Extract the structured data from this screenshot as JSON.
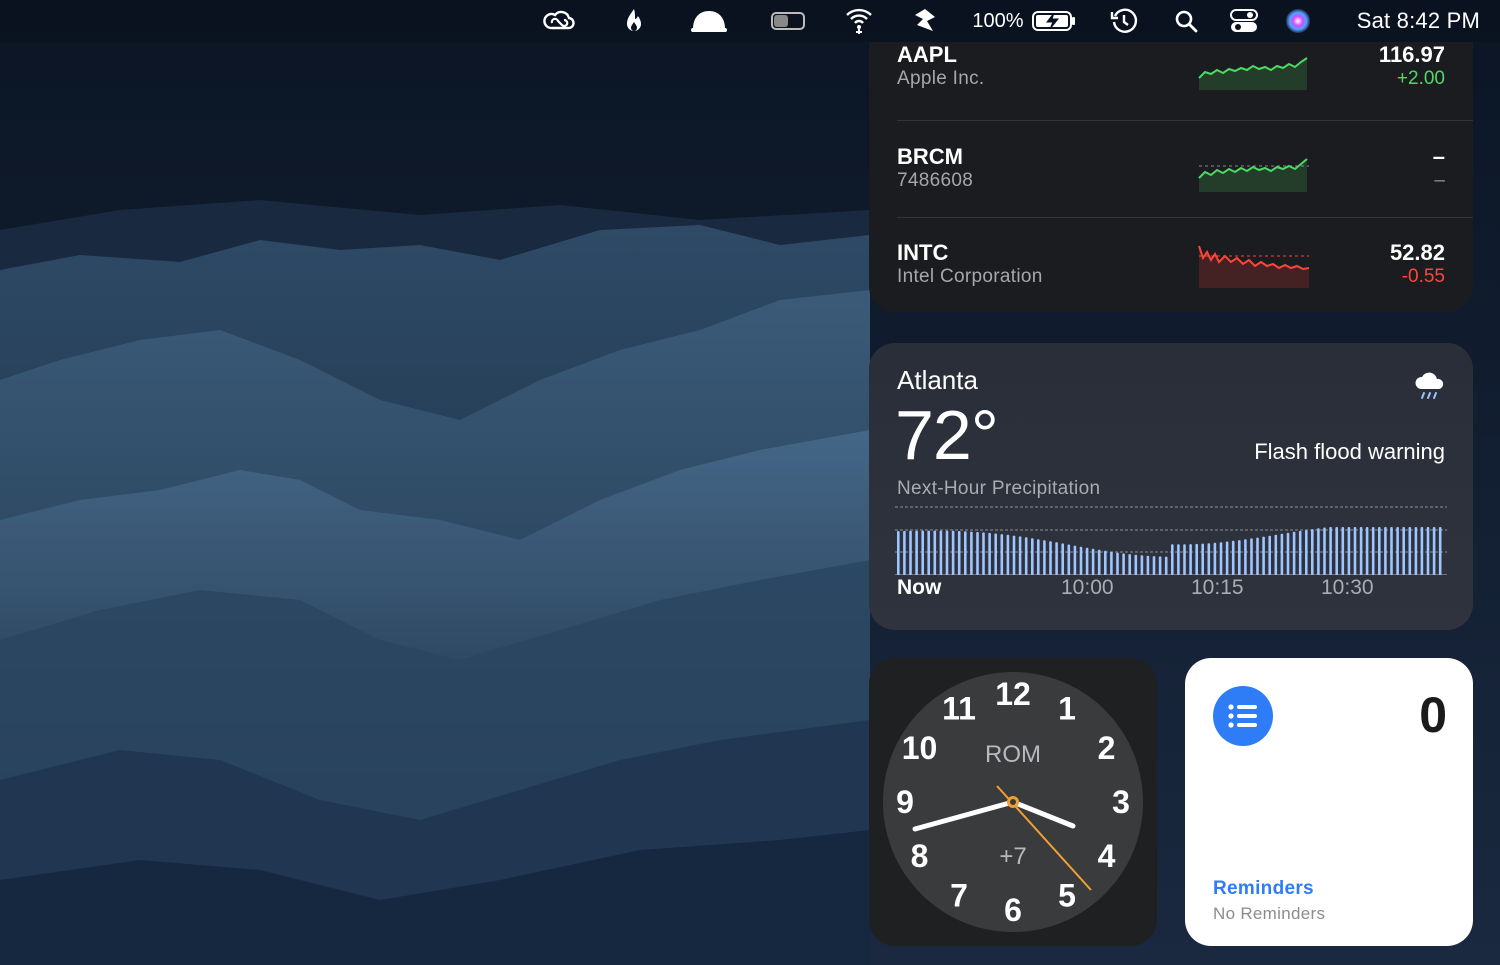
{
  "menubar": {
    "icons": [
      "creative-cloud-icon",
      "flame-icon",
      "bell-dome-icon",
      "toggle-icon",
      "wifi-icon",
      "app-shield-icon",
      "battery-icon",
      "time-machine-icon",
      "search-icon",
      "control-center-icon",
      "siri-icon"
    ],
    "battery_percent": "100%",
    "clock": "Sat 8:42 PM"
  },
  "stocks": {
    "rows": [
      {
        "symbol": "AAPL",
        "name": "Apple Inc.",
        "price": "116.97",
        "change": "+2.00",
        "change_color": "#4cd964",
        "trend": "up"
      },
      {
        "symbol": "BRCM",
        "name": "7486608",
        "price": "–",
        "change": "–",
        "change_color": "#8e8e93",
        "trend": "up"
      },
      {
        "symbol": "INTC",
        "name": "Intel Corporation",
        "price": "52.82",
        "change": "-0.55",
        "change_color": "#ff453a",
        "trend": "down"
      }
    ]
  },
  "weather": {
    "city": "Atlanta",
    "temperature": "72°",
    "alert": "Flash flood warning",
    "precip_label": "Next-Hour Precipitation",
    "ticks": [
      "Now",
      "10:00",
      "10:15",
      "10:30"
    ],
    "icon": "cloud-rain-icon",
    "accent": "#9ec5ff"
  },
  "world_clock": {
    "city": "ROM",
    "offset": "+7",
    "numerals": [
      "12",
      "1",
      "2",
      "3",
      "4",
      "5",
      "6",
      "7",
      "8",
      "9",
      "10",
      "11"
    ],
    "time": "3:42"
  },
  "reminders": {
    "count": "0",
    "title": "Reminders",
    "subtitle": "No Reminders",
    "accent": "#2e7cf6"
  }
}
